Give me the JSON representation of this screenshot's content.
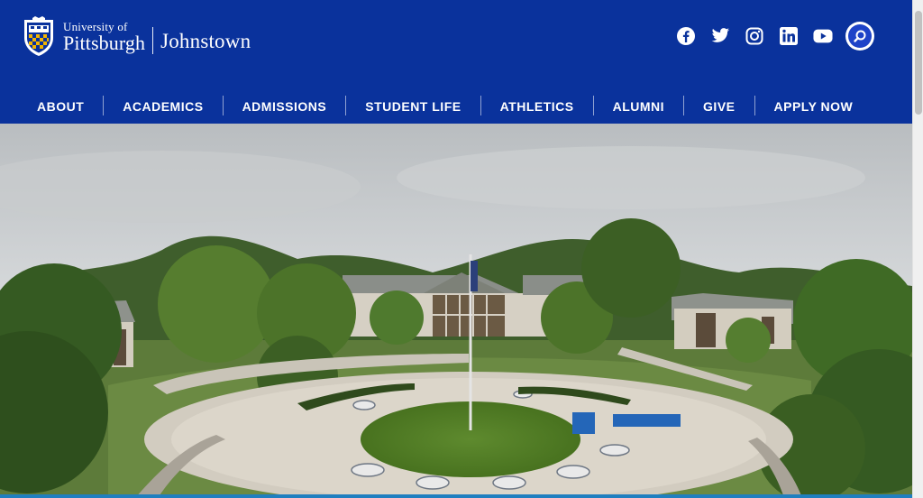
{
  "brand": {
    "university_small": "University of",
    "university_big": "Pittsburgh",
    "campus": "Johnstown",
    "colors": {
      "header_bg": "#0a329c",
      "accent_gold": "#f2b500",
      "search_blue": "#1d43c8"
    }
  },
  "social": [
    {
      "name": "facebook-icon"
    },
    {
      "name": "twitter-icon"
    },
    {
      "name": "instagram-icon"
    },
    {
      "name": "linkedin-icon"
    },
    {
      "name": "youtube-icon"
    }
  ],
  "search": {
    "icon": "search-icon"
  },
  "nav": {
    "items": [
      {
        "label": "ABOUT"
      },
      {
        "label": "ACADEMICS"
      },
      {
        "label": "ADMISSIONS"
      },
      {
        "label": "STUDENT LIFE"
      },
      {
        "label": "ATHLETICS"
      },
      {
        "label": "ALUMNI"
      },
      {
        "label": "GIVE"
      },
      {
        "label": "APPLY NOW"
      }
    ]
  },
  "hero": {
    "image": "campus-aerial-photo"
  }
}
